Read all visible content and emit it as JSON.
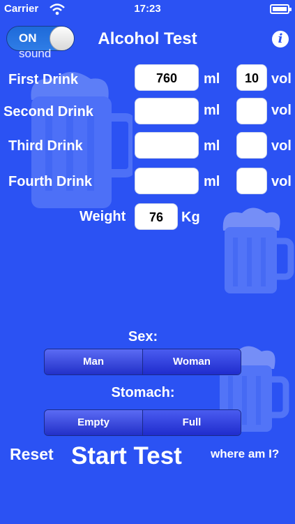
{
  "status": {
    "carrier": "Carrier",
    "time": "17:23"
  },
  "header": {
    "toggle_label": "ON",
    "sound_label": "sound",
    "title": "Alcohol Test",
    "info_glyph": "i"
  },
  "drinks": [
    {
      "label": "First Drink",
      "ml": "760",
      "ml_unit": "ml",
      "vol": "10",
      "vol_unit": "vol"
    },
    {
      "label": "Second Drink",
      "ml": "",
      "ml_unit": "ml",
      "vol": "",
      "vol_unit": "vol"
    },
    {
      "label": "Third Drink",
      "ml": "",
      "ml_unit": "ml",
      "vol": "",
      "vol_unit": "vol"
    },
    {
      "label": "Fourth Drink",
      "ml": "",
      "ml_unit": "ml",
      "vol": "",
      "vol_unit": "vol"
    }
  ],
  "weight": {
    "label": "Weight",
    "value": "76",
    "unit": "Kg"
  },
  "sex": {
    "label": "Sex:",
    "options": [
      "Man",
      "Woman"
    ],
    "selected": "Woman"
  },
  "stomach": {
    "label": "Stomach:",
    "options": [
      "Empty",
      "Full"
    ],
    "selected": "Full"
  },
  "actions": {
    "reset": "Reset",
    "start": "Start Test",
    "where": "where am I?"
  },
  "colors": {
    "background": "#2b52f3",
    "accent": "#2f7de6"
  }
}
